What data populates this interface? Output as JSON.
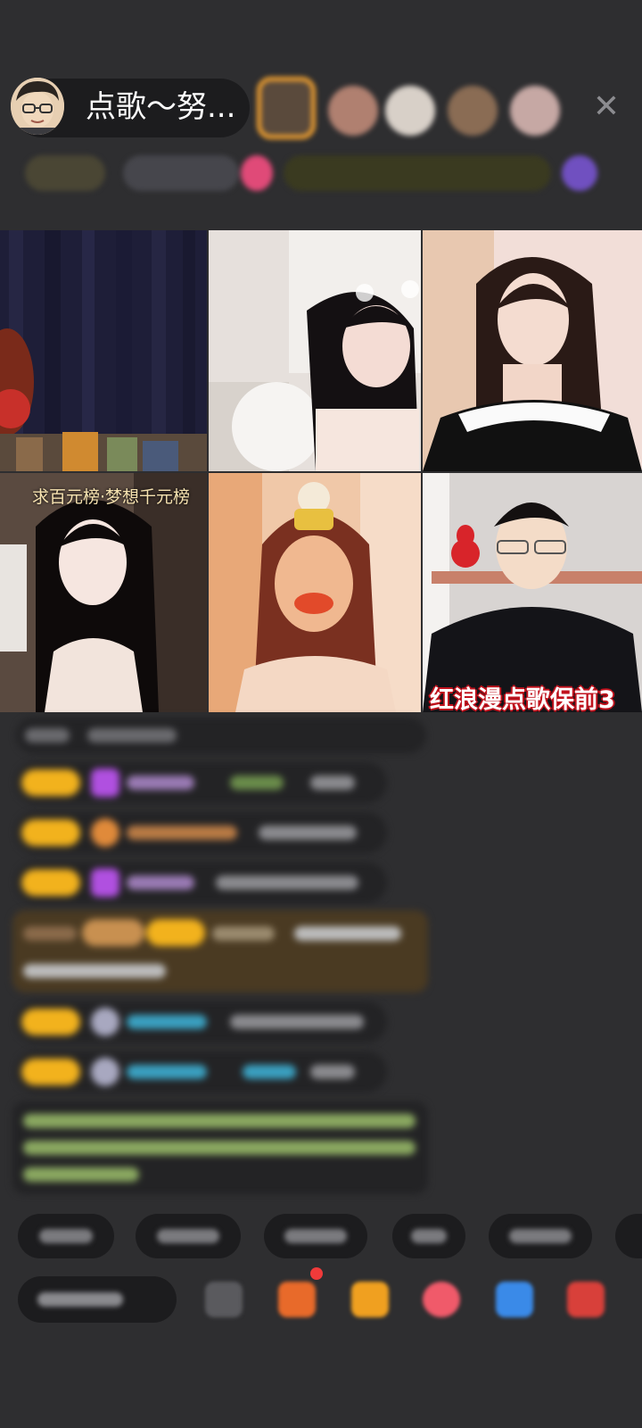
{
  "header": {
    "host_name": "点歌～努...",
    "close_icon": "close-icon"
  },
  "grid": {
    "tile4_caption": "求百元榜·梦想千元榜",
    "tile6_label": "红浪漫点歌保前3"
  },
  "colors": {
    "background": "#2e2e30",
    "pill": "#1c1c1e",
    "badge_gold": "#f2b21d",
    "label_red": "#c0121d"
  }
}
